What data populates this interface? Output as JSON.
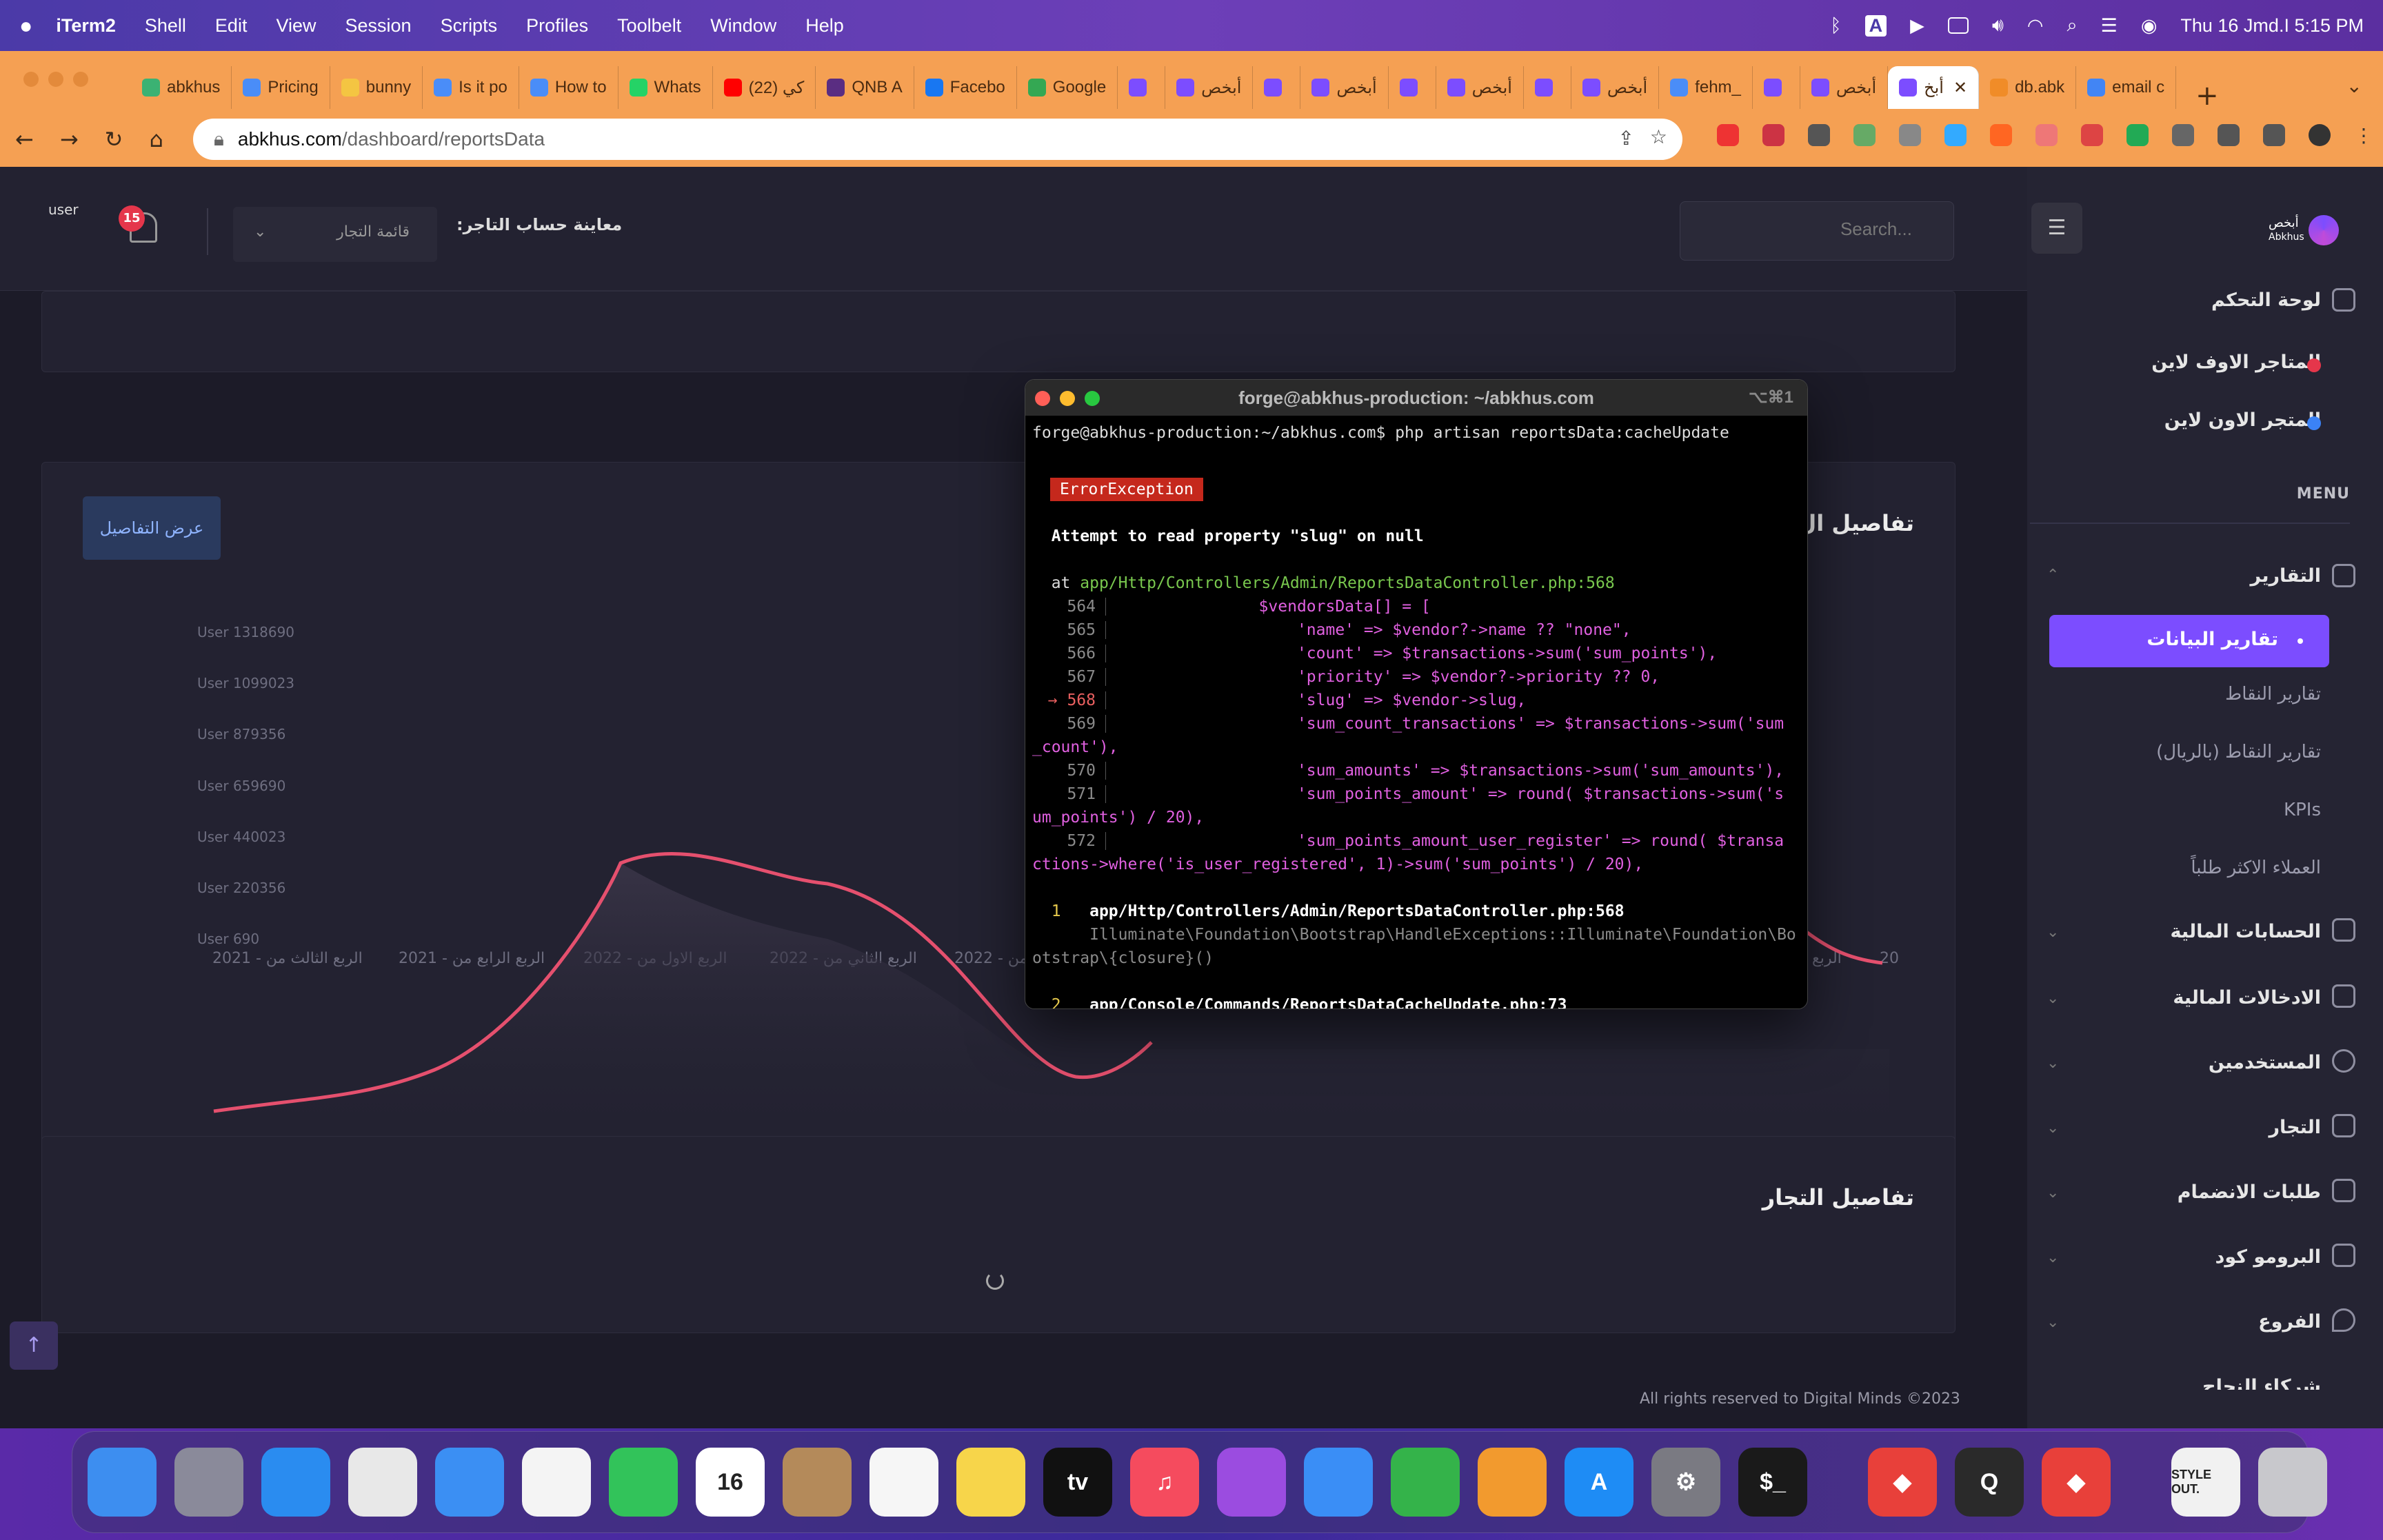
{
  "menubar": {
    "app": "iTerm2",
    "items": [
      "Shell",
      "Edit",
      "View",
      "Session",
      "Scripts",
      "Profiles",
      "Toolbelt",
      "Window",
      "Help"
    ],
    "clock": "Thu 16 Jmd.I  5:15 PM",
    "input_badge": "A"
  },
  "tabs": [
    {
      "label": "abkhus",
      "color": "#3bb273"
    },
    {
      "label": "Pricing",
      "color": "#4a8df8"
    },
    {
      "label": "bunny",
      "color": "#f4c542"
    },
    {
      "label": "Is it po",
      "color": "#4a8df8"
    },
    {
      "label": "How to",
      "color": "#4a8df8"
    },
    {
      "label": "Whats",
      "color": "#25d366"
    },
    {
      "label": "(22) كي",
      "color": "#ff0000"
    },
    {
      "label": "QNB A",
      "color": "#5a2d82"
    },
    {
      "label": "Facebo",
      "color": "#1877f2"
    },
    {
      "label": "Google",
      "color": "#34a853"
    },
    {
      "label": "",
      "color": "#7c4dff"
    },
    {
      "label": "أبخص",
      "color": "#7c4dff"
    },
    {
      "label": "",
      "color": "#7c4dff"
    },
    {
      "label": "أبخص",
      "color": "#7c4dff"
    },
    {
      "label": "",
      "color": "#7c4dff"
    },
    {
      "label": "أبخص",
      "color": "#7c4dff"
    },
    {
      "label": "",
      "color": "#7c4dff"
    },
    {
      "label": "أبخص",
      "color": "#7c4dff"
    },
    {
      "label": "fehm_",
      "color": "#4a8df8"
    },
    {
      "label": "",
      "color": "#7c4dff"
    },
    {
      "label": "أبخص",
      "color": "#7c4dff"
    },
    {
      "label": "أبخ",
      "color": "#7c4dff",
      "active": true
    },
    {
      "label": "db.abk",
      "color": "#f08c28"
    },
    {
      "label": "email c",
      "color": "#4285f4"
    }
  ],
  "address": {
    "host": "abkhus.com",
    "path": "/dashboard/reportsData"
  },
  "topbar": {
    "search_placeholder": "Search...",
    "merchant_label": "معاينة حساب التاجر:",
    "merchant_select": "قائمة التجار",
    "notif_count": "15",
    "user": "user"
  },
  "logo": {
    "ar": "أبخص",
    "en": "Abkhus"
  },
  "sidebar": {
    "top_items": [
      {
        "label": "لوحة التحكم"
      },
      {
        "label": "المتاجر الاوف لاين",
        "dot": "#e5364b"
      },
      {
        "label": "المتجر الاون لاين",
        "dot": "#3b82f6"
      }
    ],
    "menu_header": "MENU",
    "reports": "التقارير",
    "sub_items": [
      "تقارير البيانات",
      "تقارير النقاط",
      "تقارير النقاط (بالريال)",
      "KPIs",
      "العملاء الاكثر طلباً"
    ],
    "items": [
      "الحسابات المالية",
      "الادخالات المالية",
      "المستخدمين",
      "التجار",
      "طلبات الانضمام",
      "البرومو كود",
      "الفروع",
      "شركاء النجاح"
    ]
  },
  "main": {
    "details_button": "عرض التفاصيل",
    "chart_title": "تفاصيل ال",
    "merchants_title": "تفاصيل التجار",
    "footer": "All rights reserved to Digital Minds  ©2023"
  },
  "chart_data": {
    "type": "area",
    "y_ticks": [
      "User 1318690",
      "User 1099023",
      "User 879356",
      "User 659690",
      "User 440023",
      "User 220356",
      "User 690"
    ],
    "x_ticks": [
      "الربع الثالث من - 2021",
      "الربع الرابع من - 2021",
      "الربع الاول من - 2022",
      "الربع الثاني من - 2022",
      "من - 2022",
      "الربع",
      "20"
    ],
    "color": "#e5506e"
  },
  "terminal": {
    "title": "forge@abkhus-production: ~/abkhus.com",
    "shortcut": "⌥⌘1",
    "prompt": "forge@abkhus-production:~/abkhus.com$ php artisan reportsData:cacheUpdate",
    "exception": "ErrorException",
    "message": "Attempt to read property \"slug\" on null",
    "at_prefix": "at ",
    "at_file": "app/Http/Controllers/Admin/ReportsDataController.php:568",
    "code": [
      {
        "n": "564",
        "t": "                $vendorsData[] = ["
      },
      {
        "n": "565",
        "t": "                    'name' => $vendor?->name ?? \"none\","
      },
      {
        "n": "566",
        "t": "                    'count' => $transactions->sum('sum_points'),"
      },
      {
        "n": "567",
        "t": "                    'priority' => $vendor?->priority ?? 0,"
      },
      {
        "n": "→ 568",
        "t": "                    'slug' => $vendor->slug,"
      },
      {
        "n": "569",
        "t": "                    'sum_count_transactions' => $transactions->sum('sum"
      },
      {
        "n": "",
        "t": "_count'),"
      },
      {
        "n": "570",
        "t": "                    'sum_amounts' => $transactions->sum('sum_amounts'),"
      },
      {
        "n": "571",
        "t": "                    'sum_points_amount' => round( $transactions->sum('s"
      },
      {
        "n": "",
        "t": "um_points') / 20),"
      },
      {
        "n": "572",
        "t": "                    'sum_points_amount_user_register' => round( $transa"
      },
      {
        "n": "",
        "t": "ctions->where('is_user_registered', 1)->sum('sum_points') / 20),"
      }
    ],
    "trace1_num": "1",
    "trace1_file": "app/Http/Controllers/Admin/ReportsDataController.php:568",
    "trace1_detail": "Illuminate\\Foundation\\Bootstrap\\HandleExceptions::Illuminate\\Foundation\\Bo",
    "trace1_detail2": "otstrap\\{closure}()",
    "trace2_num": "2",
    "trace2_file": "app/Console/Commands/ReportsDataCacheUpdate.php:73"
  },
  "dock": [
    {
      "name": "finder",
      "label": "",
      "color": "#3d8ef0"
    },
    {
      "name": "launchpad",
      "label": "",
      "color": "#8a8a9a"
    },
    {
      "name": "safari",
      "label": "",
      "color": "#2a8cf0"
    },
    {
      "name": "chrome",
      "label": "",
      "color": "#e8e8e8"
    },
    {
      "name": "mail",
      "label": "",
      "color": "#3b8ff3"
    },
    {
      "name": "photos",
      "label": "",
      "color": "#f4f4f4"
    },
    {
      "name": "facetime",
      "label": "",
      "color": "#32c35a"
    },
    {
      "name": "calendar",
      "label": "16",
      "color": "#ffffff"
    },
    {
      "name": "contacts",
      "label": "",
      "color": "#b48a5a"
    },
    {
      "name": "reminders",
      "label": "",
      "color": "#f6f6f6"
    },
    {
      "name": "notes",
      "label": "",
      "color": "#f7d54a"
    },
    {
      "name": "tv",
      "label": "tv",
      "color": "#111111"
    },
    {
      "name": "music",
      "label": "♫",
      "color": "#f54b5e"
    },
    {
      "name": "podcasts",
      "label": "",
      "color": "#9b4ce0"
    },
    {
      "name": "keynote",
      "label": "",
      "color": "#3a8ef6"
    },
    {
      "name": "numbers",
      "label": "",
      "color": "#34b34a"
    },
    {
      "name": "pages",
      "label": "",
      "color": "#f29a2e"
    },
    {
      "name": "app-store",
      "label": "A",
      "color": "#1e8cf5"
    },
    {
      "name": "system-settings",
      "label": "⚙",
      "color": "#7a7a82"
    },
    {
      "name": "terminal",
      "label": "$_",
      "color": "#1a1a1a"
    },
    {
      "name": "anydesk",
      "label": "◆",
      "color": "#e8403a"
    },
    {
      "name": "quicktime",
      "label": "Q",
      "color": "#2a2a2a"
    },
    {
      "name": "anydesk-2",
      "label": "◆",
      "color": "#e8403a"
    },
    {
      "name": "style-out",
      "label": "STYLE OUT.",
      "color": "#f1f1f1"
    },
    {
      "name": "trash",
      "label": "",
      "color": "#c8c8cc"
    }
  ]
}
